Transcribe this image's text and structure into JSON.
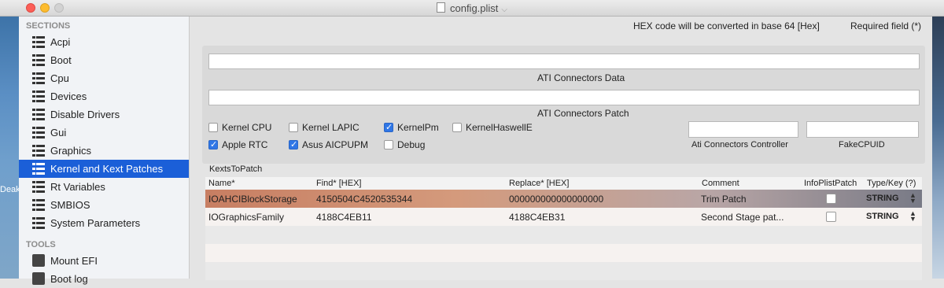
{
  "window": {
    "title": "config.plist"
  },
  "desktop": {
    "left_label": "Deak"
  },
  "sidebar": {
    "sections_header": "SECTIONS",
    "items": [
      {
        "label": "Acpi"
      },
      {
        "label": "Boot"
      },
      {
        "label": "Cpu"
      },
      {
        "label": "Devices"
      },
      {
        "label": "Disable Drivers"
      },
      {
        "label": "Gui"
      },
      {
        "label": "Graphics"
      },
      {
        "label": "Kernel and Kext Patches",
        "selected": true
      },
      {
        "label": "Rt Variables"
      },
      {
        "label": "SMBIOS"
      },
      {
        "label": "System Parameters"
      }
    ],
    "tools_header": "TOOLS",
    "tools": [
      {
        "label": "Mount EFI",
        "icon": "mount-icon"
      },
      {
        "label": "Boot log",
        "icon": "log-icon"
      }
    ]
  },
  "header": {
    "hex_note": "HEX code will be converted in base 64 [Hex]",
    "required_note": "Required field (*)"
  },
  "form": {
    "ati_connectors_data": {
      "label": "ATI Connectors Data",
      "value": ""
    },
    "ati_connectors_patch": {
      "label": "ATI Connectors Patch",
      "value": ""
    },
    "checkboxes": [
      {
        "label": "Kernel CPU",
        "checked": false
      },
      {
        "label": "Kernel LAPIC",
        "checked": false
      },
      {
        "label": "KernelPm",
        "checked": true
      },
      {
        "label": "KernelHaswellE",
        "checked": false
      },
      {
        "label": "Apple RTC",
        "checked": true
      },
      {
        "label": "Asus AICPUPM",
        "checked": true
      },
      {
        "label": "Debug",
        "checked": false
      }
    ],
    "ati_controller": {
      "label": "Ati Connectors Controller",
      "value": ""
    },
    "fake_cpuid": {
      "label": "FakeCPUID",
      "value": ""
    }
  },
  "kexts": {
    "caption": "KextsToPatch",
    "columns": [
      "Name*",
      "Find* [HEX]",
      "Replace* [HEX]",
      "Comment",
      "InfoPlistPatch",
      "Type/Key (?)"
    ],
    "rows": [
      {
        "name": "IOAHCIBlockStorage",
        "find": "4150504C4520535344",
        "replace": "000000000000000000",
        "comment": "Trim Patch",
        "info_plist_patch": false,
        "type": "STRING",
        "selected": true
      },
      {
        "name": "IOGraphicsFamily",
        "find": "4188C4EB11",
        "replace": "4188C4EB31",
        "comment": "Second Stage pat...",
        "info_plist_patch": false,
        "type": "STRING",
        "selected": false
      }
    ]
  },
  "colors": {
    "selection": "#1b5fd8",
    "accent_check": "#2f76e6"
  }
}
